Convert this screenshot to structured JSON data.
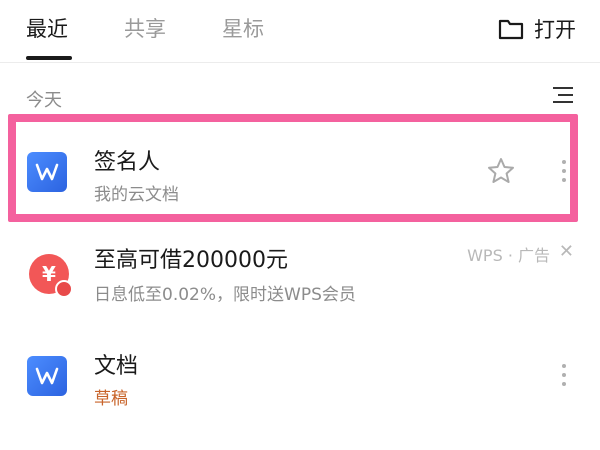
{
  "tabs": [
    {
      "label": "最近",
      "active": true
    },
    {
      "label": "共享",
      "active": false
    },
    {
      "label": "星标",
      "active": false
    }
  ],
  "open_button": {
    "label": "打开",
    "icon": "folder-icon"
  },
  "section": {
    "label": "今天",
    "sort_icon": "sort-icon"
  },
  "files": [
    {
      "title": "签名人",
      "subtitle": "我的云文档",
      "icon": "wps-writer-icon",
      "starred": false,
      "highlighted": true
    },
    {
      "title": "文档",
      "subtitle": "草稿",
      "icon": "wps-writer-icon"
    }
  ],
  "ad": {
    "title": "至高可借200000元",
    "subtitle": "日息低至0.02%，限时送WPS会员",
    "tag": "WPS · 广告",
    "close": "✕",
    "icon_glyph": "¥"
  },
  "colors": {
    "accent": "#2c63e0",
    "highlight": "#f4619e",
    "draft": "#c8642a",
    "ad_icon": "#f25757"
  }
}
